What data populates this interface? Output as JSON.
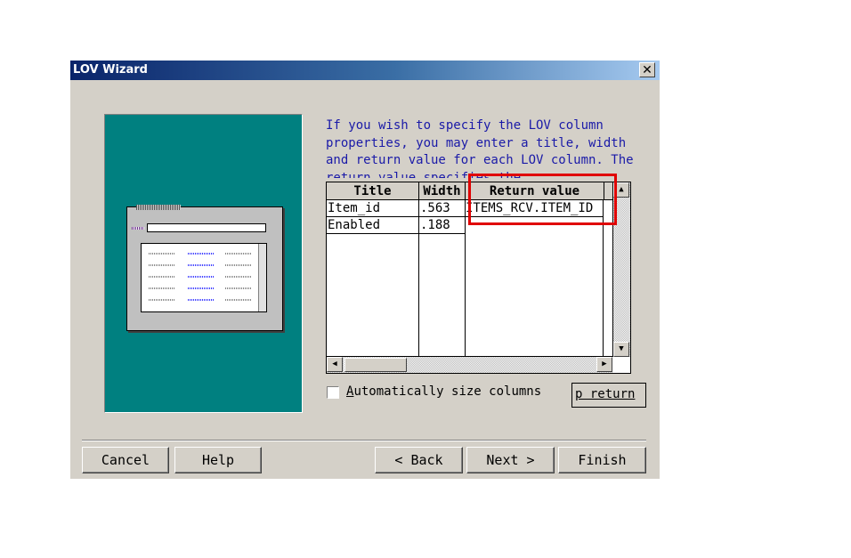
{
  "window": {
    "title": "LOV Wizard",
    "close_glyph": "✕"
  },
  "instruction": "If you wish to specify the LOV column properties, you may enter a title, width and return value for each LOV column. The return value specifies the",
  "grid": {
    "columns": [
      "Title",
      "Width",
      "Return value"
    ],
    "rows": [
      {
        "title": "Item_id",
        "width": ".563",
        "return_value": "ITEMS_RCV.ITEM_ID"
      },
      {
        "title": "Enabled",
        "width": ".188",
        "return_value": ""
      }
    ]
  },
  "checkbox": {
    "accel": "A",
    "rest": "utomatically size columns",
    "checked": false
  },
  "lookup_button": {
    "label": "Lookup return",
    "visible_text": "p return"
  },
  "buttons": {
    "cancel": "Cancel",
    "help": "Help",
    "back": "< Back",
    "next": "Next >",
    "finish": "Finish"
  },
  "colors": {
    "title_bar": "#0a246a",
    "instruction_text": "#1a1aa8",
    "illustration_bg": "#008080",
    "highlight": "#e00000",
    "face": "#d4d0c8"
  },
  "icons": [
    "close-icon",
    "up-arrow-icon",
    "down-arrow-icon",
    "left-arrow-icon",
    "right-arrow-icon"
  ]
}
